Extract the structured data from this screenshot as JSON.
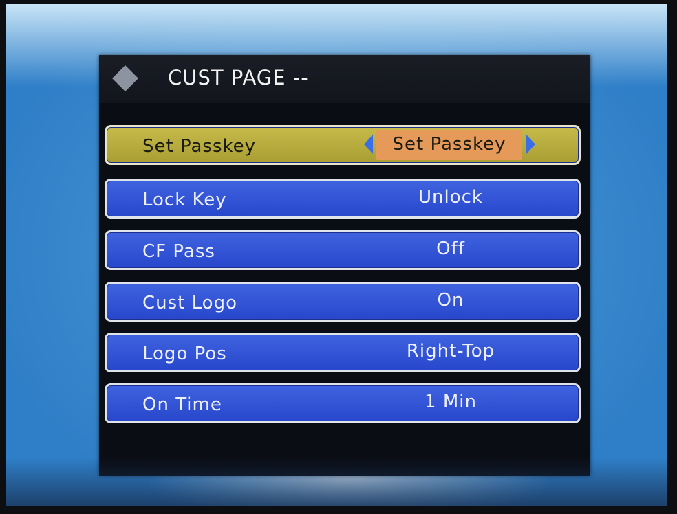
{
  "header": {
    "title": "CUST PAGE --",
    "icon": "diamond-icon"
  },
  "colors": {
    "row_bg": "#2f50d4",
    "selected_row_bg": "#b8ac3e",
    "selected_value_bg": "#e59a5a",
    "arrow": "#3a6ee8"
  },
  "menu": {
    "items": [
      {
        "label": "Set Passkey",
        "value": "Set Passkey",
        "selected": true
      },
      {
        "label": "Lock Key",
        "value": "Unlock",
        "selected": false
      },
      {
        "label": "CF Pass",
        "value": "Off",
        "selected": false
      },
      {
        "label": "Cust Logo",
        "value": "On",
        "selected": false
      },
      {
        "label": "Logo Pos",
        "value": "Right-Top",
        "selected": false
      },
      {
        "label": "On Time",
        "value": "1 Min",
        "selected": false
      }
    ]
  }
}
